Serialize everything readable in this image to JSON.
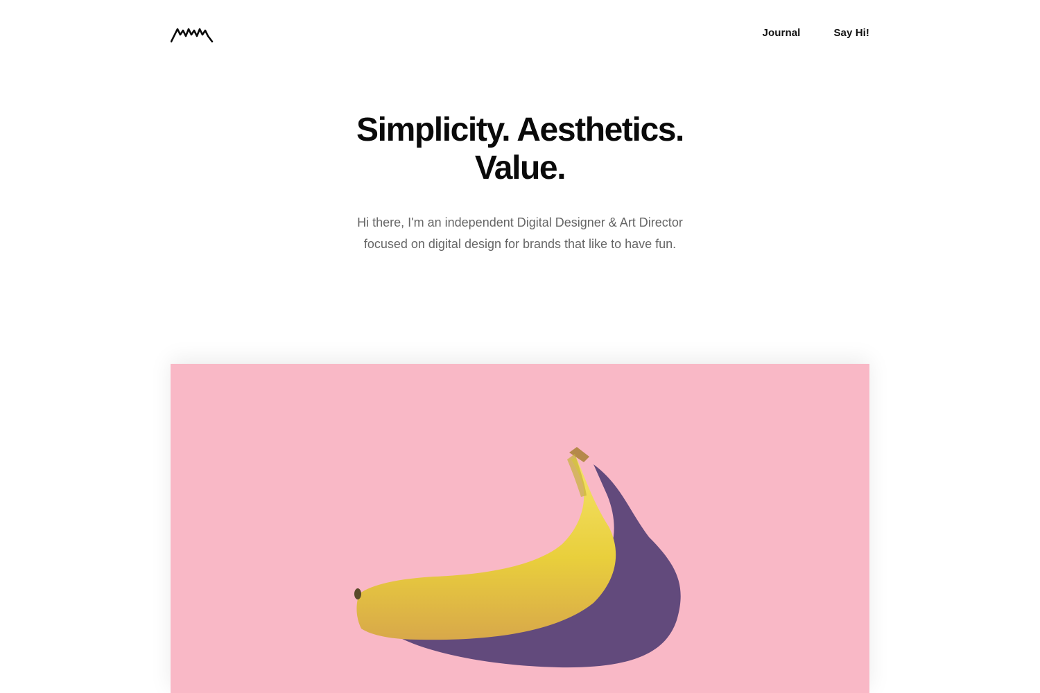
{
  "header": {
    "logo_icon": "wave-monogram-logo",
    "nav": [
      {
        "label": "Journal"
      },
      {
        "label": "Say Hi!"
      }
    ]
  },
  "hero": {
    "title_line1": "Simplicity. Aesthetics.",
    "title_line2": "Value.",
    "description": "Hi there, I'm an independent Digital Designer & Art Director focused on digital design for brands that like to have fun."
  },
  "feature": {
    "background_color": "#f9b8c6",
    "image_subject": "banana-on-pink-image"
  }
}
